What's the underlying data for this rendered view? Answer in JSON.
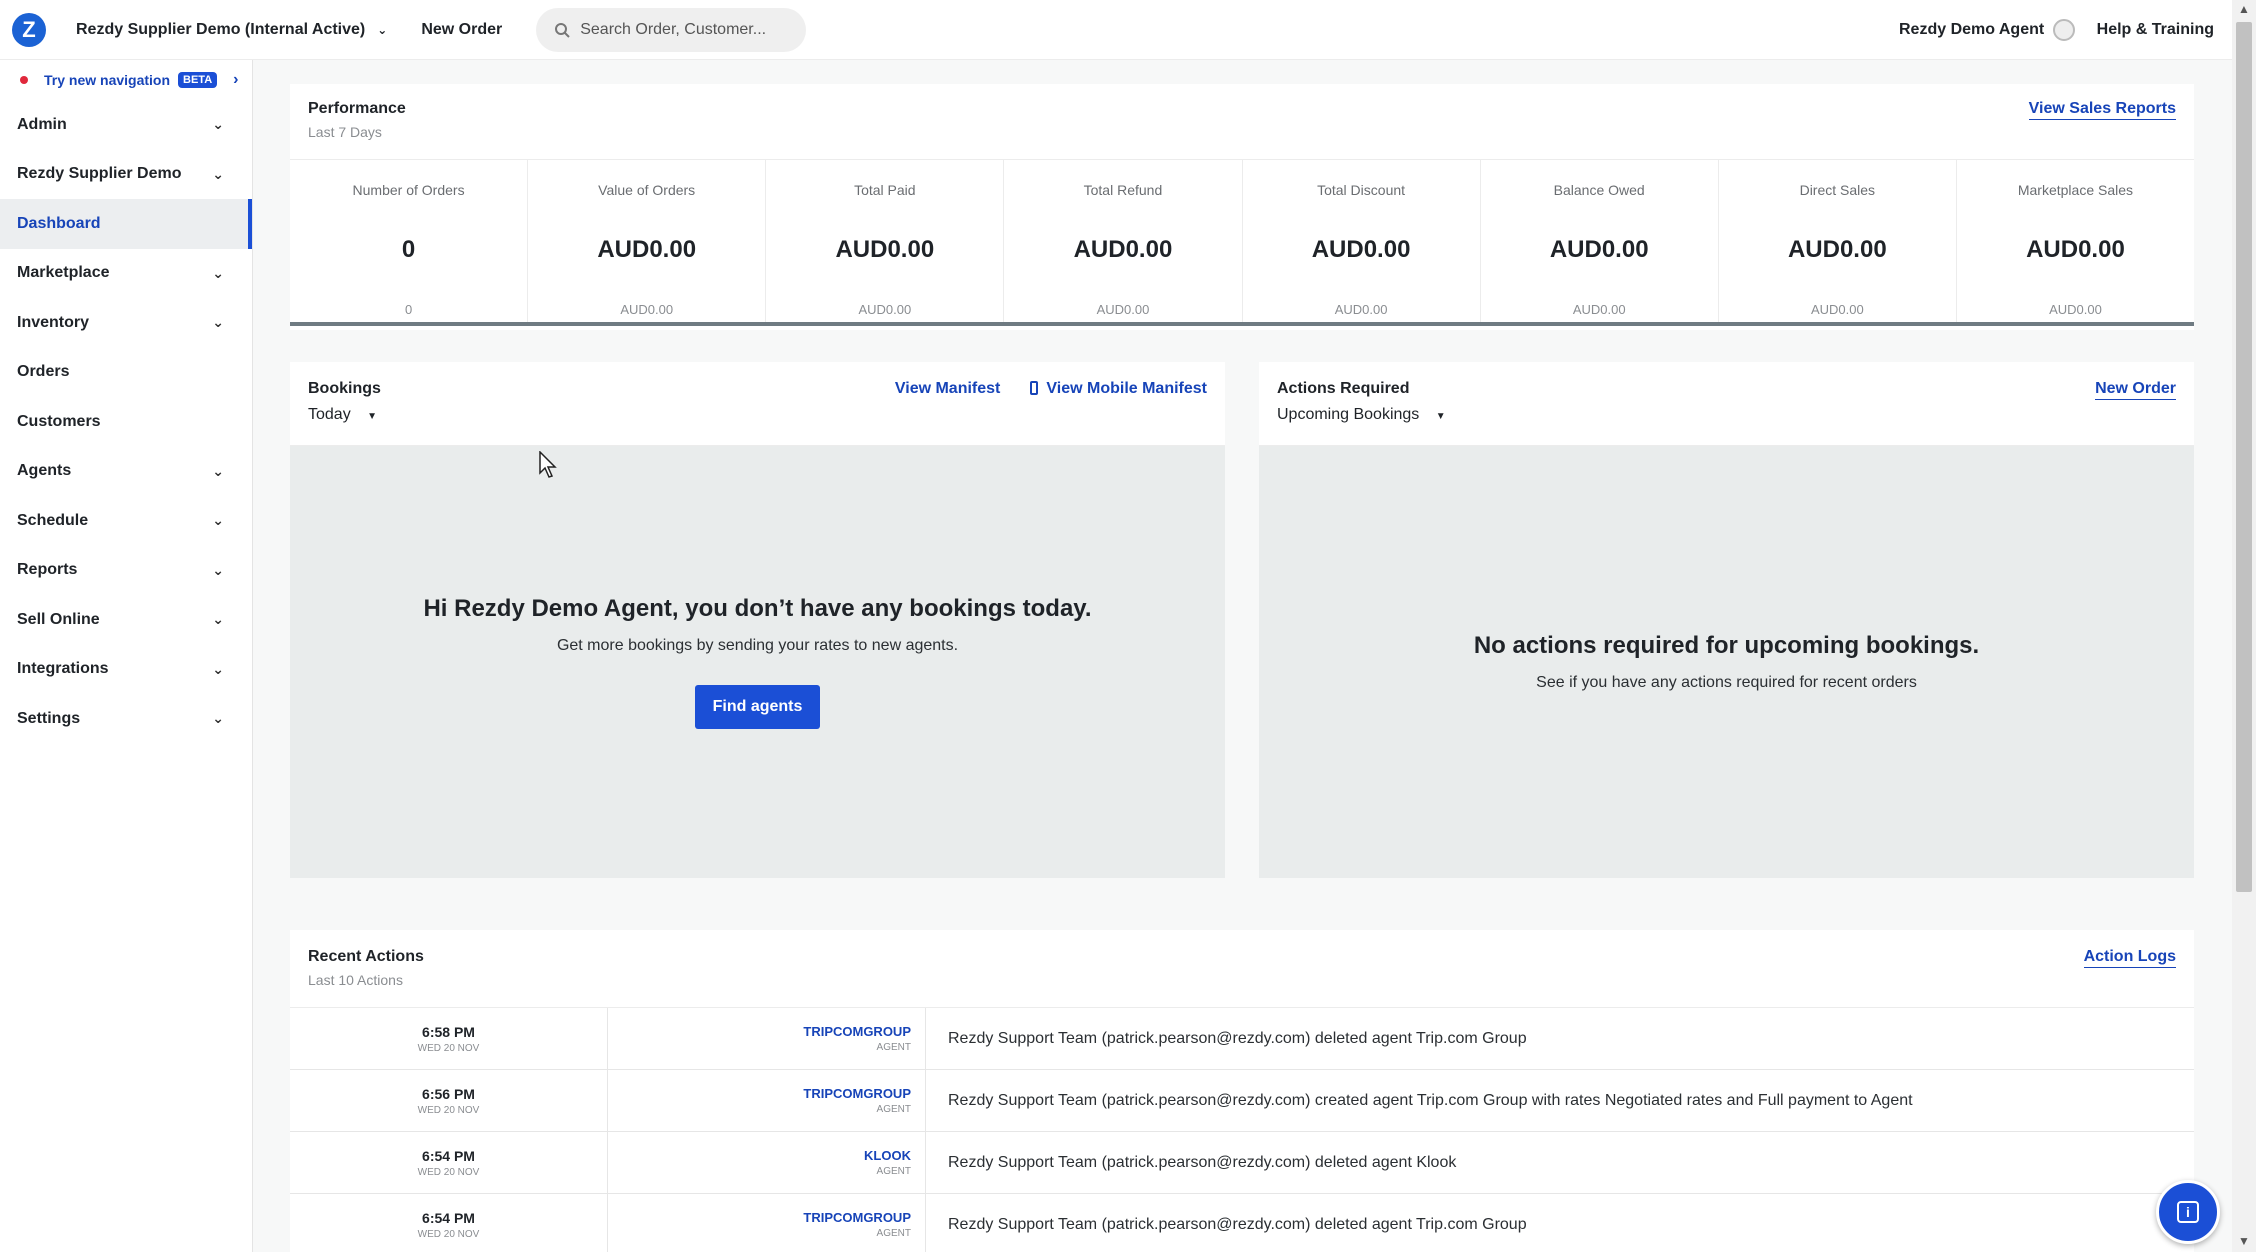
{
  "topbar": {
    "account": "Rezdy Supplier Demo (Internal Active)",
    "new_order": "New Order",
    "search_placeholder": "Search Order, Customer...",
    "agent": "Rezdy Demo Agent",
    "help": "Help & Training"
  },
  "sidebar": {
    "try_nav": "Try new navigation",
    "beta": "BETA",
    "items": [
      {
        "label": "Admin",
        "chevron": true
      },
      {
        "label": "Rezdy Supplier Demo",
        "chevron": true
      },
      {
        "label": "Dashboard",
        "chevron": false,
        "active": true
      },
      {
        "label": "Marketplace",
        "chevron": true
      },
      {
        "label": "Inventory",
        "chevron": true
      },
      {
        "label": "Orders",
        "chevron": false
      },
      {
        "label": "Customers",
        "chevron": false
      },
      {
        "label": "Agents",
        "chevron": true
      },
      {
        "label": "Schedule",
        "chevron": true
      },
      {
        "label": "Reports",
        "chevron": true
      },
      {
        "label": "Sell Online",
        "chevron": true
      },
      {
        "label": "Integrations",
        "chevron": true
      },
      {
        "label": "Settings",
        "chevron": true
      }
    ]
  },
  "performance": {
    "title": "Performance",
    "subtitle": "Last 7 Days",
    "link": "View Sales Reports",
    "metrics": [
      {
        "label": "Number of Orders",
        "value": "0",
        "prev": "0"
      },
      {
        "label": "Value of Orders",
        "value": "AUD0.00",
        "prev": "AUD0.00"
      },
      {
        "label": "Total Paid",
        "value": "AUD0.00",
        "prev": "AUD0.00"
      },
      {
        "label": "Total Refund",
        "value": "AUD0.00",
        "prev": "AUD0.00"
      },
      {
        "label": "Total Discount",
        "value": "AUD0.00",
        "prev": "AUD0.00"
      },
      {
        "label": "Balance Owed",
        "value": "AUD0.00",
        "prev": "AUD0.00"
      },
      {
        "label": "Direct Sales",
        "value": "AUD0.00",
        "prev": "AUD0.00"
      },
      {
        "label": "Marketplace Sales",
        "value": "AUD0.00",
        "prev": "AUD0.00"
      }
    ]
  },
  "bookings": {
    "title": "Bookings",
    "filter": "Today",
    "link_manifest": "View Manifest",
    "link_mobile": "View Mobile Manifest",
    "empty_title": "Hi Rezdy Demo Agent, you don’t have any bookings today.",
    "empty_sub": "Get more bookings by sending your rates to new agents.",
    "button": "Find agents"
  },
  "actions_required": {
    "title": "Actions Required",
    "filter": "Upcoming Bookings",
    "link": "New Order",
    "empty_title": "No actions required for upcoming bookings.",
    "empty_sub": "See if you have any actions required for recent orders"
  },
  "recent": {
    "title": "Recent Actions",
    "subtitle": "Last 10 Actions",
    "link": "Action Logs",
    "rows": [
      {
        "time": "6:58 PM",
        "date": "WED 20 NOV",
        "entity": "TRIPCOMGROUP",
        "type": "AGENT",
        "message": "Rezdy Support Team (patrick.pearson@rezdy.com) deleted agent Trip.com Group"
      },
      {
        "time": "6:56 PM",
        "date": "WED 20 NOV",
        "entity": "TRIPCOMGROUP",
        "type": "AGENT",
        "message": "Rezdy Support Team (patrick.pearson@rezdy.com) created agent Trip.com Group with rates Negotiated rates and Full payment to Agent"
      },
      {
        "time": "6:54 PM",
        "date": "WED 20 NOV",
        "entity": "KLOOK",
        "type": "AGENT",
        "message": "Rezdy Support Team (patrick.pearson@rezdy.com) deleted agent Klook"
      },
      {
        "time": "6:54 PM",
        "date": "WED 20 NOV",
        "entity": "TRIPCOMGROUP",
        "type": "AGENT",
        "message": "Rezdy Support Team (patrick.pearson@rezdy.com) deleted agent Trip.com Group"
      }
    ]
  }
}
